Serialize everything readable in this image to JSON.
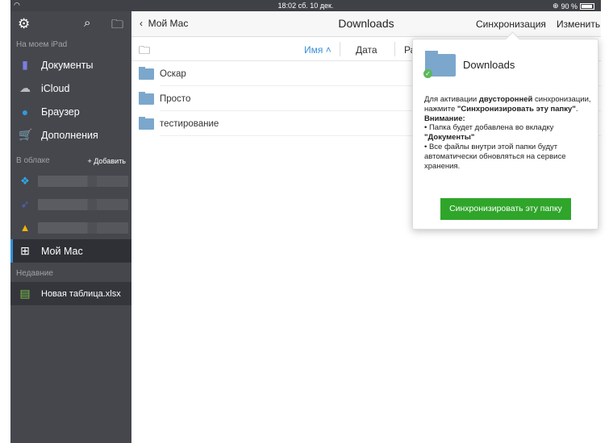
{
  "status": {
    "time": "18:02 сб. 10 дек.",
    "battery": "90 %",
    "battery_level": 0.9
  },
  "sidebar": {
    "on_ipad": "На моем iPad",
    "items": [
      {
        "label": "Документы",
        "icon": "document-icon"
      },
      {
        "label": "iCloud",
        "icon": "cloud-icon"
      },
      {
        "label": "Браузер",
        "icon": "compass-icon"
      },
      {
        "label": "Дополнения",
        "icon": "cart-icon"
      }
    ],
    "in_cloud": "В облаке",
    "add": "+ Добавить",
    "selected": "Мой Мас",
    "recent": "Недавние",
    "recent_file": "Новая таблица.xlsx"
  },
  "nav": {
    "back": "Мой Мас",
    "title": "Downloads",
    "sync": "Синхронизация",
    "edit": "Изменить"
  },
  "sort": {
    "name": "Имя",
    "date": "Дата",
    "size": "Ра"
  },
  "files": [
    "Оскар",
    "Просто",
    "тестирование"
  ],
  "popover": {
    "title": "Downloads",
    "t1": "Для активации ",
    "t1b": "двусторонней",
    "t2": " синхронизации, нажмите ",
    "t3b": "\"Синхронизировать эту папку\"",
    "t3": ".",
    "t4b": "Внимание:",
    "t5": "• Папка будет добавлена во вкладку ",
    "t5b": "\"Документы\"",
    "t6": "• Все файлы внутри этой папки будут автоматически обновляться на сервисе хранения.",
    "button": "Синхронизировать эту папку"
  },
  "colors": {
    "accent": "#3c8fd6",
    "sync_button": "#2fa52a",
    "sidebar": "#45474d"
  }
}
